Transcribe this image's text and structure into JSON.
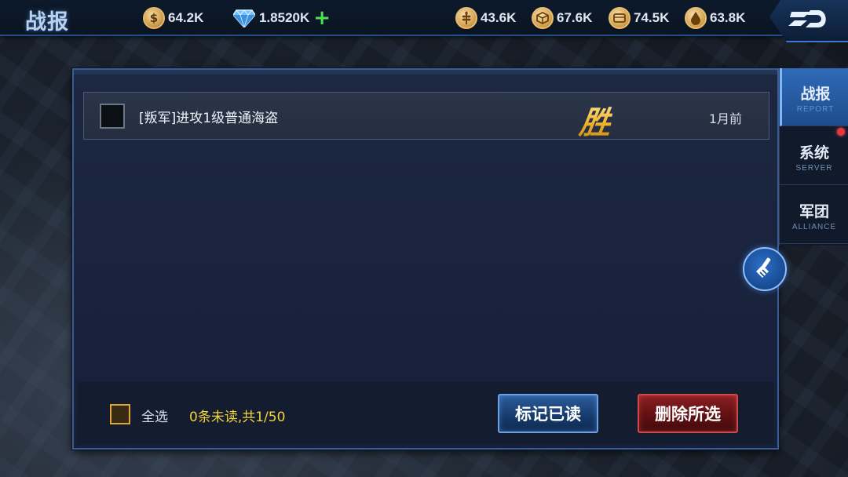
{
  "header": {
    "title": "战报",
    "resources": {
      "silver": "64.2K",
      "gems": "1.8520K",
      "food": "43.6K",
      "wood": "67.6K",
      "stone": "74.5K",
      "oil": "63.8K"
    }
  },
  "report_list": {
    "items": [
      {
        "title": "[叛军]进攻1级普通海盗",
        "result": "胜",
        "time": "1月前"
      }
    ]
  },
  "footer": {
    "select_all_label": "全选",
    "unread_summary": "0条未读,共1/50",
    "mark_read_label": "标记已读",
    "delete_selected_label": "删除所选"
  },
  "tabs": [
    {
      "label": "战报",
      "sub": "REPORT"
    },
    {
      "label": "系统",
      "sub": "SERVER"
    },
    {
      "label": "军团",
      "sub": "ALLIANCE"
    }
  ],
  "colors": {
    "accent_blue": "#2f6bb8",
    "victory_gold": "#f5c440",
    "unread_yellow": "#f2d33a",
    "delete_red": "#8a1e22"
  },
  "icons": {
    "silver": "silver-coin-icon",
    "gems": "diamond-icon",
    "food": "wheat-icon",
    "wood": "crate-icon",
    "stone": "stone-block-icon",
    "oil": "oil-drop-icon",
    "logo": "game-logo-icon",
    "clear": "broom-icon"
  }
}
